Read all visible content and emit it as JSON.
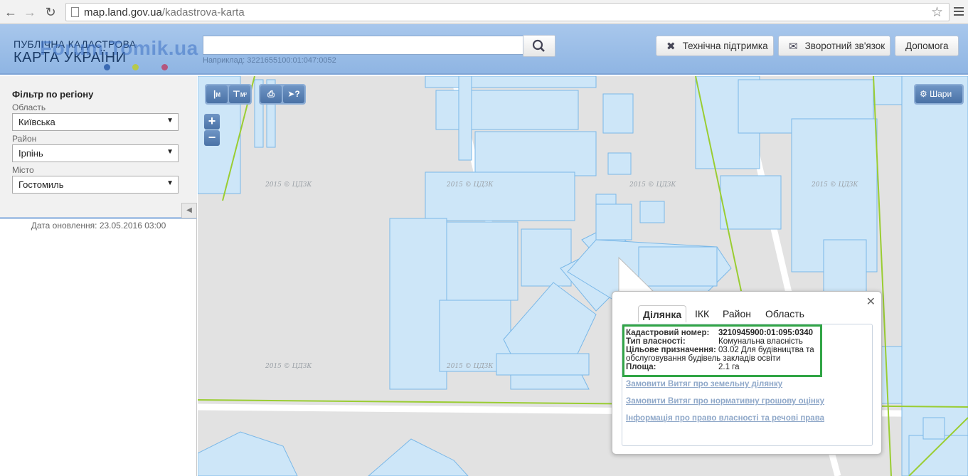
{
  "browser": {
    "url_host": "map.land.gov.ua",
    "url_path": "/kadastrova-karta"
  },
  "header": {
    "logo_line1": "ПУБЛІЧНА КАДАСТРОВА",
    "logo_line2": "КАРТА УКРАЇНИ",
    "watermark": "Forum.Tomik.ua",
    "search_value": "",
    "search_hint": "Наприклад: 3221655100:01:047:0052",
    "buttons": {
      "support": "Технічна підтримка",
      "feedback": "Зворотний зв'язок",
      "help": "Допомога"
    }
  },
  "filter": {
    "title": "Фільтр по регіону",
    "oblast_label": "Область",
    "oblast_value": "Київська",
    "rayon_label": "Район",
    "rayon_value": "Ірпінь",
    "misto_label": "Місто",
    "misto_value": "Гостомиль",
    "update_date": "Дата оновлення: 23.05.2016 03:00"
  },
  "map": {
    "tools": {
      "measure_length": "М",
      "measure_area": "М²",
      "layers": "Шари"
    },
    "watermarks": [
      "2015 © ЦДЗК",
      "2015 © ЦДЗК",
      "2015 © ЦДЗК",
      "2015 © ЦДЗК",
      "2015 © ЦДЗК",
      "2015 © ЦДЗК"
    ]
  },
  "popup": {
    "tabs": [
      "Ділянка",
      "ІКК",
      "Район",
      "Область"
    ],
    "active_tab": "Ділянка",
    "fields": {
      "cadastral_label": "Кадастровий номер:",
      "cadastral_value": "3210945900:01:095:0340",
      "ownership_label": "Тип власності:",
      "ownership_value": "Комунальна власність",
      "purpose_label": "Цільове призначення:",
      "purpose_value_1": "03.02 Для будівництва та",
      "purpose_value_2": "обслуговування будівель закладів освіти",
      "area_label": "Площа:",
      "area_value": "2.1 га"
    },
    "links": {
      "extract_parcel": "Замовити Витяг про земельну ділянку",
      "extract_valuation": "Замовити Витяг про нормативну грошову оцінку",
      "rights_info": "Інформація про право власності та речові права"
    }
  },
  "colors": {
    "header_bg": "#9fbfe8",
    "parcel_fill": "#cde6f8",
    "parcel_stroke": "#7ab8e8",
    "boundary_green": "#9acd32",
    "highlight_green": "#31a546",
    "map_bg": "#e2e2e2"
  }
}
